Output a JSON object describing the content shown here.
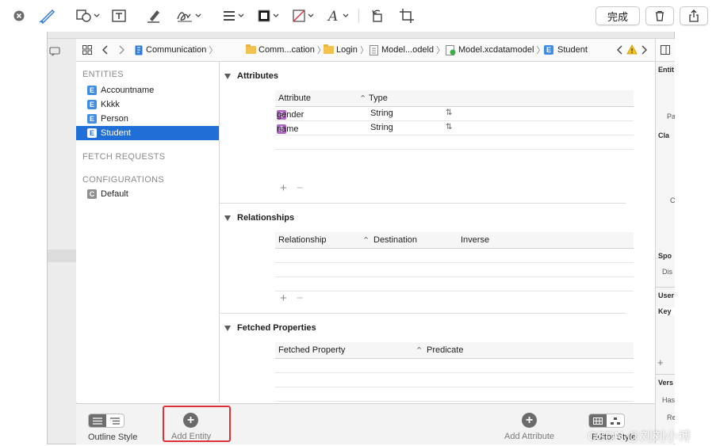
{
  "markup_toolbar": {
    "done_label": "完成",
    "icons": [
      "close-icon",
      "pen-icon",
      "shapes-icon",
      "text-box-icon",
      "highlighter-icon",
      "signature-icon",
      "line-style-icon",
      "border-color-icon",
      "fill-color-icon",
      "font-icon",
      "rotate-icon",
      "crop-icon",
      "trash-icon",
      "share-icon"
    ]
  },
  "jump_bar": {
    "items": [
      "Communication",
      "Comm...cation",
      "Login",
      "Model...odeld",
      "Model.xcdatamodel",
      "Student"
    ]
  },
  "outline": {
    "entities_header": "ENTITIES",
    "entities": [
      "Accountname",
      "Kkkk",
      "Person",
      "Student"
    ],
    "selected": "Student",
    "fetch_requests_header": "FETCH REQUESTS",
    "configurations_header": "CONFIGURATIONS",
    "configurations": [
      "Default"
    ],
    "entity_badge": "E",
    "config_badge": "C"
  },
  "attributes": {
    "title": "Attributes",
    "columns": [
      "Attribute",
      "Type"
    ],
    "rows": [
      {
        "badge": "S",
        "name": "gender",
        "type": "String"
      },
      {
        "badge": "S",
        "name": "name",
        "type": "String"
      }
    ]
  },
  "relationships": {
    "title": "Relationships",
    "columns": [
      "Relationship",
      "Destination",
      "Inverse"
    ]
  },
  "fetched_properties": {
    "title": "Fetched Properties",
    "columns": [
      "Fetched Property",
      "Predicate"
    ]
  },
  "bottom_bar": {
    "outline_style_label": "Outline Style",
    "add_entity_label": "Add Entity",
    "add_attribute_label": "Add Attribute",
    "editor_style_label": "Editor Style"
  },
  "inspector": {
    "labels": [
      "Entit",
      "Pa",
      "Cla",
      "C",
      "Spo",
      "Dis",
      "User",
      "Key",
      "Vers",
      "Has",
      "Re"
    ]
  },
  "watermark": "CSDN @刘刘小博",
  "colors": {
    "selection": "#1f6fd6",
    "entity_badge": "#3f8ee3",
    "attribute_badge": "#b365c8",
    "highlight_box": "#e0303a"
  }
}
